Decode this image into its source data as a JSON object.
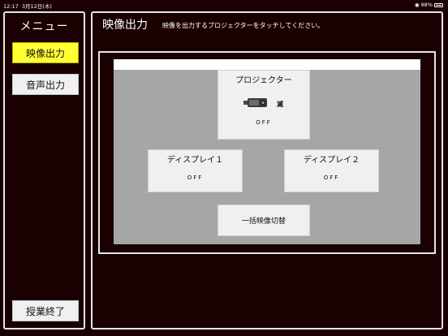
{
  "status_bar": {
    "time": "12:17",
    "date": "3月12日(木)",
    "battery": "98%"
  },
  "sidebar": {
    "title": "メニュー",
    "items": [
      {
        "label": "映像出力",
        "active": true
      },
      {
        "label": "音声出力",
        "active": false
      }
    ],
    "end_label": "授業終了"
  },
  "main": {
    "title": "映像出力",
    "instruction": "映像を出力するプロジェクターをタッチしてください。",
    "projector": {
      "label": "プロジェクター",
      "state": "滅",
      "output": "OFF",
      "icon": "projector-icon"
    },
    "displays": [
      {
        "label": "ディスプレイ１",
        "output": "OFF"
      },
      {
        "label": "ディスプレイ２",
        "output": "OFF"
      }
    ],
    "batch_label": "一括映像切替"
  },
  "colors": {
    "background": "#1a0000",
    "active": "#ffff33",
    "area": "#a6a6a6",
    "button": "#f0f0f0"
  }
}
